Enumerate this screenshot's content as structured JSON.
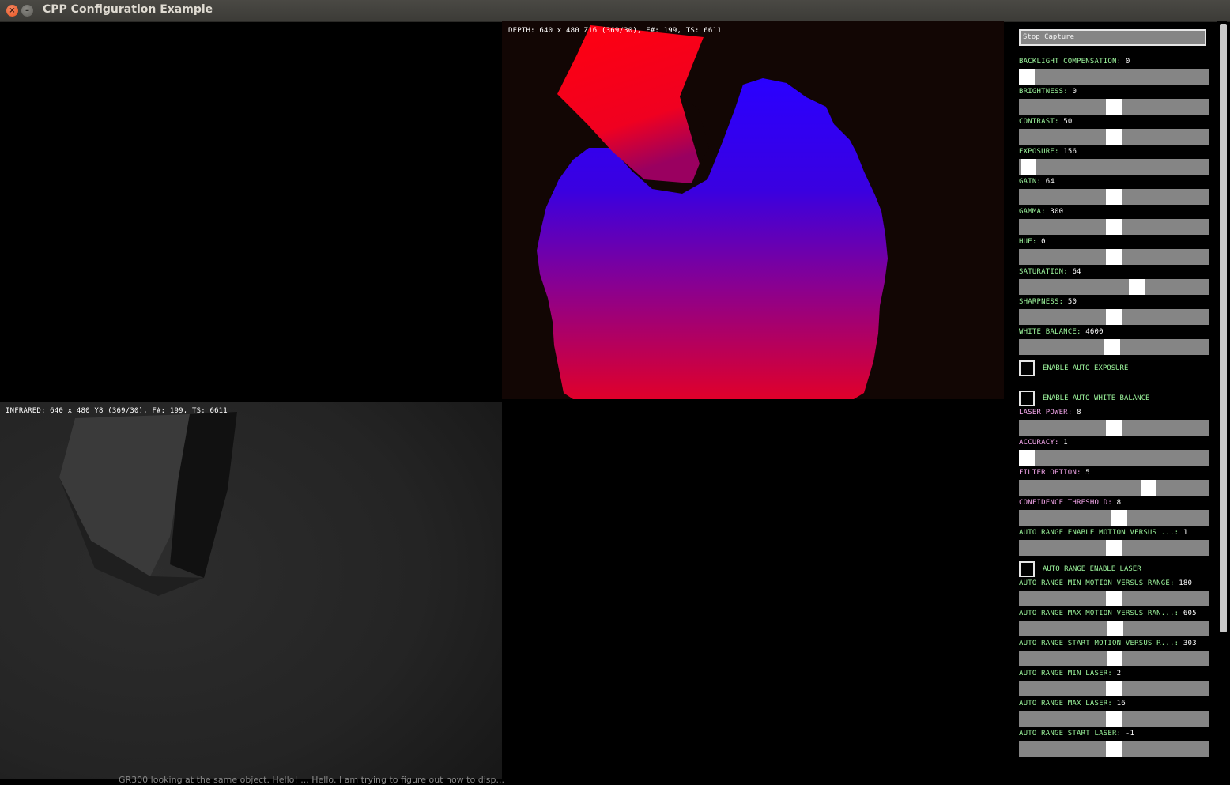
{
  "window": {
    "title": "CPP Configuration Example",
    "close_glyph": "×",
    "minimize_glyph": "–"
  },
  "streams": {
    "depth": {
      "overlay": "DEPTH: 640 x 480 Z16 (369/30), F#: 199, TS: 6611"
    },
    "infrared": {
      "overlay": "INFRARED: 640 x 480 Y8 (369/30), F#: 199, TS: 6611"
    }
  },
  "panel": {
    "capture_button": "Stop Capture",
    "colors": {
      "color_group": "#9cf59c",
      "depth_group": "#f3a6ea",
      "slider_track": "#858585"
    },
    "controls": [
      {
        "id": "backlight-compensation",
        "type": "slider",
        "group": "green",
        "label": "BACKLIGHT COMPENSATION",
        "value": "0",
        "fraction": 0.0
      },
      {
        "id": "brightness",
        "type": "slider",
        "group": "green",
        "label": "BRIGHTNESS",
        "value": "0",
        "fraction": 0.5
      },
      {
        "id": "contrast",
        "type": "slider",
        "group": "green",
        "label": "CONTRAST",
        "value": "50",
        "fraction": 0.5
      },
      {
        "id": "exposure",
        "type": "slider",
        "group": "green",
        "label": "EXPOSURE",
        "value": "156",
        "fraction": 0.01
      },
      {
        "id": "gain",
        "type": "slider",
        "group": "green",
        "label": "GAIN",
        "value": "64",
        "fraction": 0.5
      },
      {
        "id": "gamma",
        "type": "slider",
        "group": "green",
        "label": "GAMMA",
        "value": "300",
        "fraction": 0.5
      },
      {
        "id": "hue",
        "type": "slider",
        "group": "green",
        "label": "HUE",
        "value": "0",
        "fraction": 0.5
      },
      {
        "id": "saturation",
        "type": "slider",
        "group": "green",
        "label": "SATURATION",
        "value": "64",
        "fraction": 0.63
      },
      {
        "id": "sharpness",
        "type": "slider",
        "group": "green",
        "label": "SHARPNESS",
        "value": "50",
        "fraction": 0.5
      },
      {
        "id": "white-balance",
        "type": "slider",
        "group": "green",
        "label": "WHITE BALANCE",
        "value": "4600",
        "fraction": 0.49
      },
      {
        "id": "enable-auto-exposure",
        "type": "checkbox",
        "group": "green",
        "label": "ENABLE AUTO EXPOSURE",
        "checked": false
      },
      {
        "id": "enable-auto-white-balance",
        "type": "checkbox",
        "group": "green",
        "label": "ENABLE AUTO WHITE BALANCE",
        "checked": false
      },
      {
        "id": "laser-power",
        "type": "slider",
        "group": "pink",
        "label": "LASER POWER",
        "value": "8",
        "fraction": 0.5
      },
      {
        "id": "accuracy",
        "type": "slider",
        "group": "pink",
        "label": "ACCURACY",
        "value": "1",
        "fraction": 0.0
      },
      {
        "id": "filter-option",
        "type": "slider",
        "group": "pink",
        "label": "FILTER OPTION",
        "value": "5",
        "fraction": 0.7
      },
      {
        "id": "confidence-threshold",
        "type": "slider",
        "group": "pink",
        "label": "CONFIDENCE THRESHOLD",
        "value": "8",
        "fraction": 0.53
      },
      {
        "id": "auto-range-enable-motion-versus",
        "type": "slider",
        "group": "green",
        "label": "AUTO RANGE ENABLE MOTION VERSUS ...",
        "value": "1",
        "fraction": 0.5
      },
      {
        "id": "auto-range-enable-laser",
        "type": "checkbox",
        "group": "green",
        "label": "AUTO RANGE ENABLE LASER",
        "checked": false
      },
      {
        "id": "auto-range-min-motion-versus-range",
        "type": "slider",
        "group": "green",
        "label": "AUTO RANGE MIN MOTION VERSUS RANGE",
        "value": "180",
        "fraction": 0.5
      },
      {
        "id": "auto-range-max-motion-versus-range",
        "type": "slider",
        "group": "green",
        "label": "AUTO RANGE MAX MOTION VERSUS RAN...",
        "value": "605",
        "fraction": 0.51
      },
      {
        "id": "auto-range-start-motion-versus-range",
        "type": "slider",
        "group": "green",
        "label": "AUTO RANGE START MOTION VERSUS R...",
        "value": "303",
        "fraction": 0.505
      },
      {
        "id": "auto-range-min-laser",
        "type": "slider",
        "group": "green",
        "label": "AUTO RANGE MIN LASER",
        "value": "2",
        "fraction": 0.5
      },
      {
        "id": "auto-range-max-laser",
        "type": "slider",
        "group": "green",
        "label": "AUTO RANGE MAX LASER",
        "value": "16",
        "fraction": 0.5
      },
      {
        "id": "auto-range-start-laser",
        "type": "slider",
        "group": "green",
        "label": "AUTO RANGE START LASER",
        "value": "-1",
        "fraction": 0.5
      }
    ]
  },
  "background_text": "GR300 looking at the same object. Hello! ... Hello. I am trying to figure out how to disp..."
}
